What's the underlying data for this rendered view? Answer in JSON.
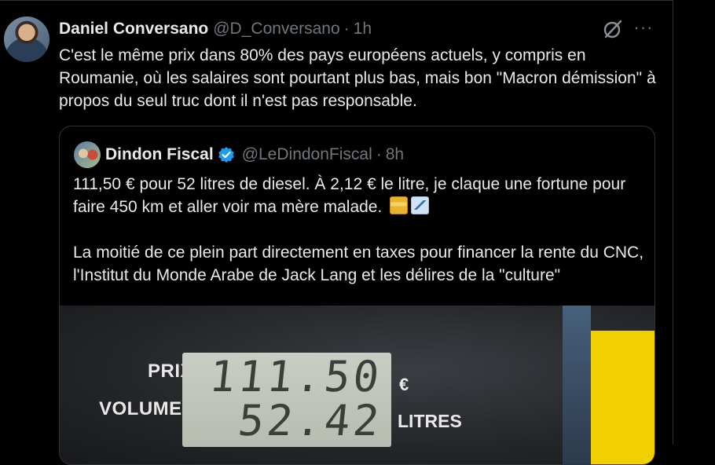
{
  "post": {
    "author_name": "Daniel Conversano",
    "author_handle": "@D_Conversano",
    "separator": "·",
    "time": "1h",
    "more_label": "···",
    "text": "C'est le même prix dans 80% des pays européens actuels, y compris en Roumanie, où les salaires sont pourtant plus bas, mais bon \"Macron démission\" à propos du seul truc dont il n'est pas responsable."
  },
  "quoted_post": {
    "author_name": "Dindon Fiscal",
    "author_handle": "@LeDindonFiscal",
    "separator": "·",
    "time": "8h",
    "verified_color": "#1d9bf0",
    "paragraph_1": "111,50 € pour 52 litres de diesel. À 2,12 € le litre, je claque une fortune pour faire 450 km et aller voir ma mère malade.",
    "emoji_1": "fuel-pump-emoji",
    "emoji_2": "chart-decreasing-emoji",
    "paragraph_2": "La moitié de ce plein part directement en taxes pour financer la rente du CNC, l'Institut du Monde Arabe de Jack Lang et les délires de la \"culture\"",
    "media": {
      "label_price": "PRIX",
      "label_volume": "VOLUME",
      "price_display": "111.50",
      "volume_display": "52.42",
      "currency_symbol": "€",
      "unit_label": "LITRES"
    }
  },
  "colors": {
    "background": "#000000",
    "text_primary": "#e7e9ea",
    "text_secondary": "#71767b",
    "border": "#2f3336"
  }
}
